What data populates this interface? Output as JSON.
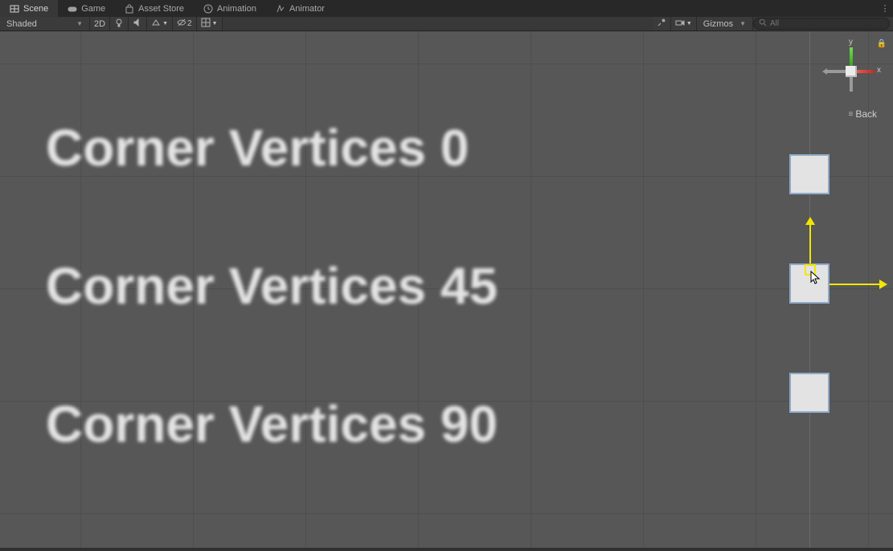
{
  "tabs": {
    "scene": {
      "label": "Scene"
    },
    "game": {
      "label": "Game"
    },
    "assetstore": {
      "label": "Asset Store"
    },
    "animation": {
      "label": "Animation"
    },
    "animator": {
      "label": "Animator"
    }
  },
  "toolbar": {
    "shading_mode": "Shaded",
    "mode_2d": "2D",
    "layers_badge": "2",
    "gizmos_label": "Gizmos"
  },
  "search": {
    "placeholder": "All",
    "value": ""
  },
  "orient": {
    "y": "y",
    "x": "x",
    "back": "Back"
  },
  "scene_labels": {
    "l0": "Corner Vertices 0",
    "l1": "Corner Vertices 45",
    "l2": "Corner Vertices 90"
  }
}
